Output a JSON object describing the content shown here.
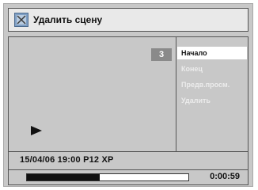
{
  "dialog": {
    "title": "Удалить сцену",
    "icon": "scene-delete-icon"
  },
  "scene": {
    "number": "3"
  },
  "menu": {
    "items": [
      {
        "label": "Начало",
        "active": true
      },
      {
        "label": "Конец",
        "active": false
      },
      {
        "label": "Предв.просм.",
        "active": false
      },
      {
        "label": "Удалить",
        "active": false
      }
    ]
  },
  "recording": {
    "info": "15/04/06  19:00  P12  XP",
    "elapsed": "0:00:59",
    "progress_fraction": 0.45
  },
  "colors": {
    "panel": "#c8c8c8",
    "highlight": "#ffffff",
    "disabled_text": "#ececec",
    "progress_fill": "#111111"
  }
}
